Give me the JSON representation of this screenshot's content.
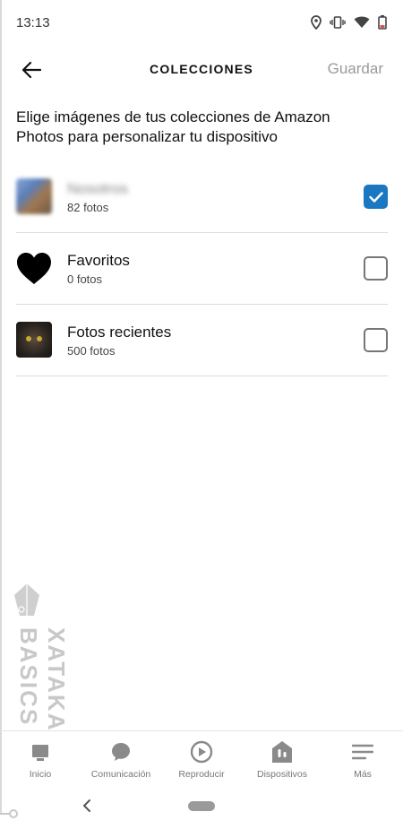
{
  "status_bar": {
    "time": "13:13",
    "icons": [
      "location-icon",
      "vibrate-icon",
      "wifi-icon",
      "battery-icon"
    ]
  },
  "header": {
    "title": "COLECCIONES",
    "back_icon": "arrow-left-icon",
    "save_label": "Guardar"
  },
  "intro_text": "Elige imágenes de tus colecciones de Amazon Photos para personalizar tu dispositivo",
  "collections": [
    {
      "name": "Nosotros",
      "count": "82 fotos",
      "checked": true,
      "thumbnail": "blurred-photo"
    },
    {
      "name": "Favoritos",
      "count": "0 fotos",
      "checked": false,
      "thumbnail": "heart-icon"
    },
    {
      "name": "Fotos recientes",
      "count": "500 fotos",
      "checked": false,
      "thumbnail": "cat-photo"
    }
  ],
  "watermark": {
    "text": "XATAKA BASICS"
  },
  "bottom_nav": {
    "items": [
      {
        "label": "Inicio",
        "icon": "home-icon"
      },
      {
        "label": "Comunicación",
        "icon": "chat-bubble-icon"
      },
      {
        "label": "Reproducir",
        "icon": "play-icon"
      },
      {
        "label": "Dispositivos",
        "icon": "devices-icon"
      },
      {
        "label": "Más",
        "icon": "menu-icon"
      }
    ]
  },
  "colors": {
    "accent": "#1a78c2",
    "nav_icon": "#8a8a8a",
    "save_disabled": "#9a9a9a"
  }
}
